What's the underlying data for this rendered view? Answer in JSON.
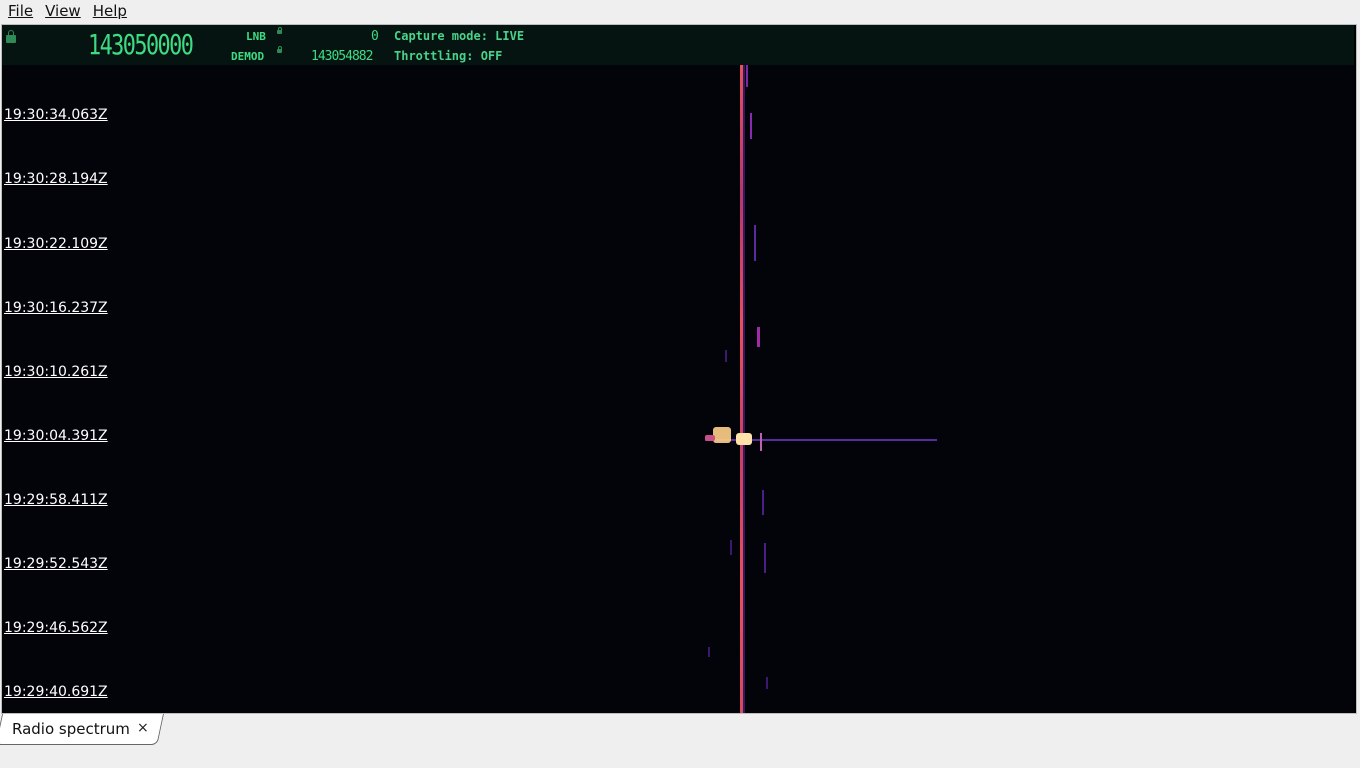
{
  "menu": {
    "file": "File",
    "view": "View",
    "help": "Help"
  },
  "header": {
    "main_frequency": "143050000",
    "lnb_label": "LNB",
    "lnb_value": "0",
    "demod_label": "DEMOD",
    "demod_value": "143054882",
    "capture_mode": "Capture mode: LIVE",
    "throttling": "Throttling: OFF"
  },
  "waterfall": {
    "timestamps": [
      "19:30:34.063Z",
      "19:30:28.194Z",
      "19:30:22.109Z",
      "19:30:16.237Z",
      "19:30:10.261Z",
      "19:30:04.391Z",
      "19:29:58.411Z",
      "19:29:52.543Z",
      "19:29:46.562Z",
      "19:29:40.691Z"
    ]
  },
  "tabs": [
    {
      "label": "Radio spectrum",
      "close": "×"
    }
  ],
  "colors": {
    "header_bg": "#061411",
    "lcd_green": "#3ddc84",
    "waterfall_bg": "#03030a",
    "carrier": "#e8505b",
    "signal_hot": "#ffd08a",
    "noise_purple": "#6a2a9a"
  }
}
